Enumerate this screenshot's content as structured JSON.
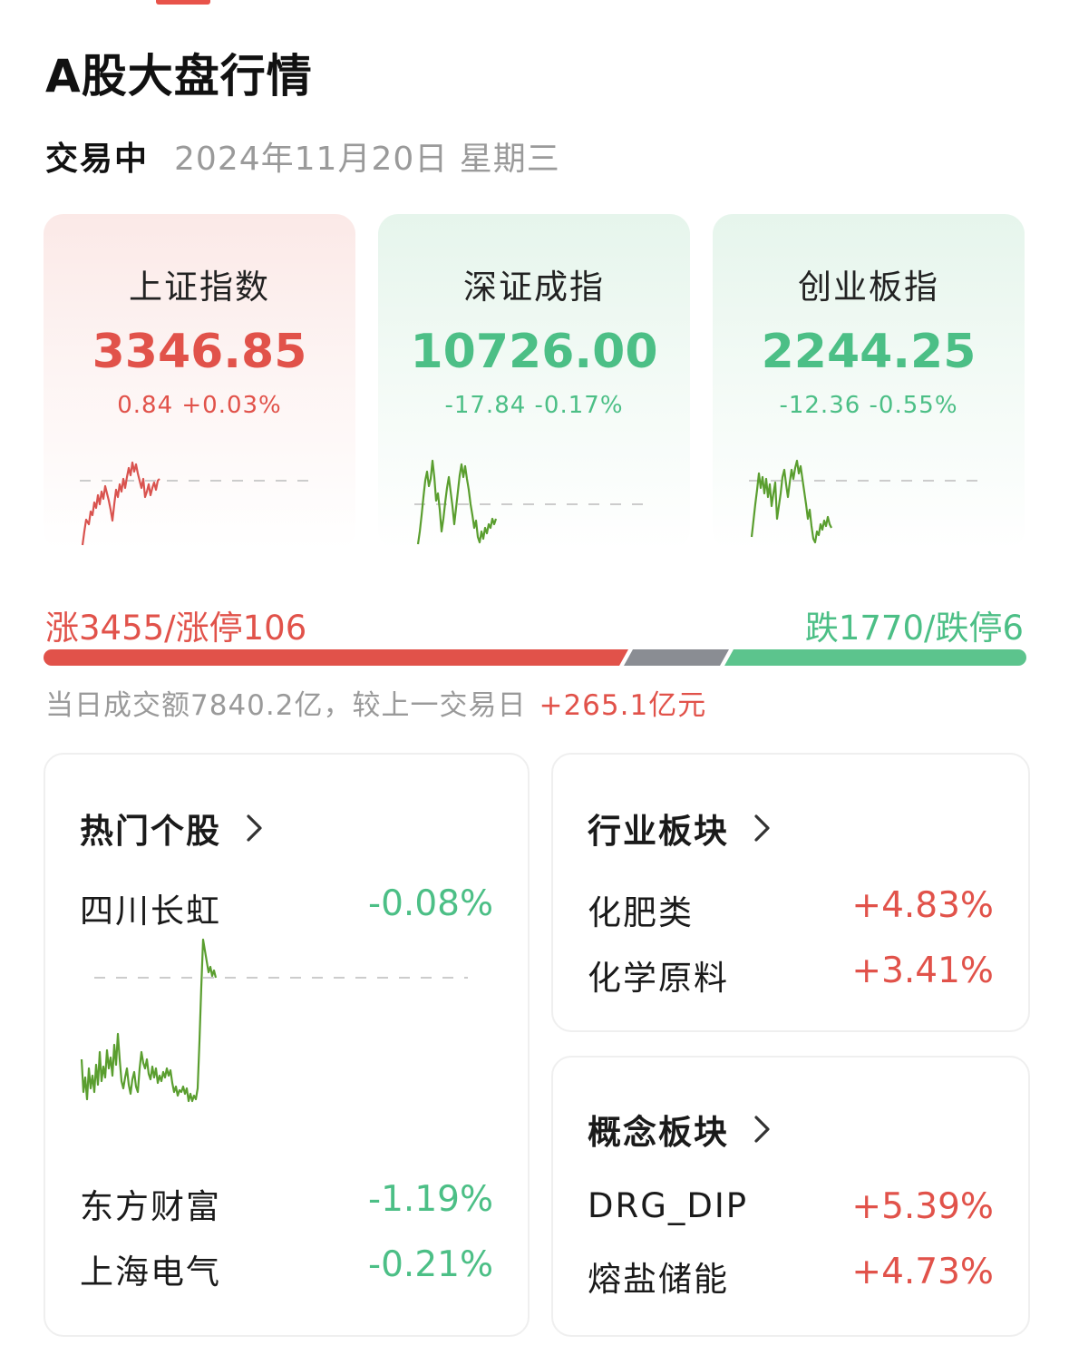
{
  "header": {
    "title": "A股大盘行情"
  },
  "status": {
    "label": "交易中",
    "date": "2024年11月20日 星期三"
  },
  "indices": [
    {
      "name": "上证指数",
      "value": "3346.85",
      "change": "0.84 +0.03%",
      "trend": "up"
    },
    {
      "name": "深证成指",
      "value": "10726.00",
      "change": "-17.84 -0.17%",
      "trend": "down"
    },
    {
      "name": "创业板指",
      "value": "2244.25",
      "change": "-12.36 -0.55%",
      "trend": "down"
    }
  ],
  "breadth": {
    "up_label": "涨3455/涨停106",
    "down_label": "跌1770/跌停6",
    "advancers": 3455,
    "decliners": 1770
  },
  "turnover": {
    "text": "当日成交额7840.2亿，较上一交易日",
    "delta": "+265.1亿元"
  },
  "hot_stocks": {
    "title": "热门个股",
    "items": [
      {
        "name": "四川长虹",
        "change": "-0.08%"
      },
      {
        "name": "东方财富",
        "change": "-1.19%"
      },
      {
        "name": "上海电气",
        "change": "-0.21%"
      }
    ]
  },
  "industry": {
    "title": "行业板块",
    "items": [
      {
        "name": "化肥类",
        "change": "+4.83%"
      },
      {
        "name": "化学原料",
        "change": "+3.41%"
      }
    ]
  },
  "concept": {
    "title": "概念板块",
    "items": [
      {
        "name": "DRG_DIP",
        "change": "+5.39%"
      },
      {
        "name": "熔盐储能",
        "change": "+4.73%"
      }
    ]
  },
  "colors": {
    "up": "#e1524a",
    "down": "#4cbf86",
    "line_up": "#d9534f",
    "line_down": "#5a9e2f",
    "flat": "#8a8d93"
  },
  "icons": {
    "chevron": "chevron-right-icon"
  }
}
